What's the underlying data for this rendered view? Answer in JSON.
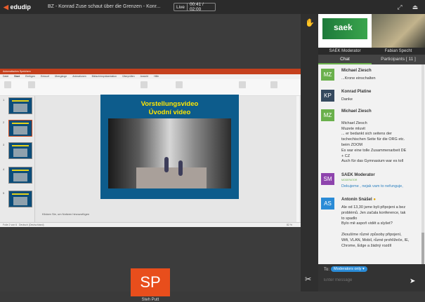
{
  "topbar": {
    "logo": "edudip",
    "title": "BZ - Konrad Zuse schaut über die Grenzen - Konr...",
    "live_label": "Live",
    "timer": "00:41 / 02:00"
  },
  "ppt": {
    "titlebar": "Automatisches Speichern",
    "tabs": [
      "Datei",
      "Start",
      "Einfügen",
      "Entwurf",
      "Übergänge",
      "Animationen",
      "Bildschirmpräsentation",
      "Überprüfen",
      "Ansicht",
      "Hilfe"
    ],
    "slide_title_1": "Vorstellungsvideo",
    "slide_title_2": "Úvodní video",
    "notes_placeholder": "Klicken Sie, um Notizen hinzuzufügen",
    "status_left": "Folie 2 von 6",
    "status_lang": "Deutsch (Deutschland)",
    "zoom": "82 %",
    "thumb_numbers": [
      "1",
      "2",
      "3",
      "4",
      "5"
    ]
  },
  "presenter": {
    "initials": "SP",
    "name": "Steh Putt"
  },
  "cams": {
    "cam1_label": "SAEK Moderator",
    "cam1_logo": "saek",
    "cam2_label": "Fabian Specht"
  },
  "tabs": {
    "chat": "Chat",
    "participants": "Participants [ 11 ]"
  },
  "messages": [
    {
      "initials": "MZ",
      "color": "#6ab04c",
      "name": "Michael Ziesch",
      "text": "...Krone einschalten"
    },
    {
      "initials": "KP",
      "color": "#35495e",
      "name": "Konrad Platine",
      "text": "Danke"
    },
    {
      "initials": "MZ",
      "color": "#6ab04c",
      "name": "Michael Ziesch",
      "text": "\nMichael Ziesch\nMuzete mluvit\n... er bedankt sich seitens der\ntschechischen Seite für die ORG etc.\nbeim ZOOM\nEs war eine tolle Zusammenarbeit DE\n+ CZ\nAuch für das Gymnasium war es toll"
    },
    {
      "initials": "SM",
      "color": "#8e44ad",
      "name": "SAEK Moderator",
      "role": "MODERATOR",
      "text": "Dekujeme , nejak vam to nefunguje,"
    },
    {
      "initials": "AS",
      "color": "#2a8bd6",
      "name": "Antonín Snášel",
      "text": "Ale od 13,30 jsme byli připojeni a bez\nproblémů. Jen začala konference, tak\nto spadlo\nBylo mě aspoň vidět a slyšet?\n\nZkoušíme různé způsoby připojení,\nWifi, VLAN, Mobil, různé prohlížeče, IE,\nChrome, Edge a žádný rozdíl"
    }
  ],
  "composer": {
    "to_label": "To:",
    "to_value": "Moderators only",
    "placeholder": "Enter message"
  }
}
